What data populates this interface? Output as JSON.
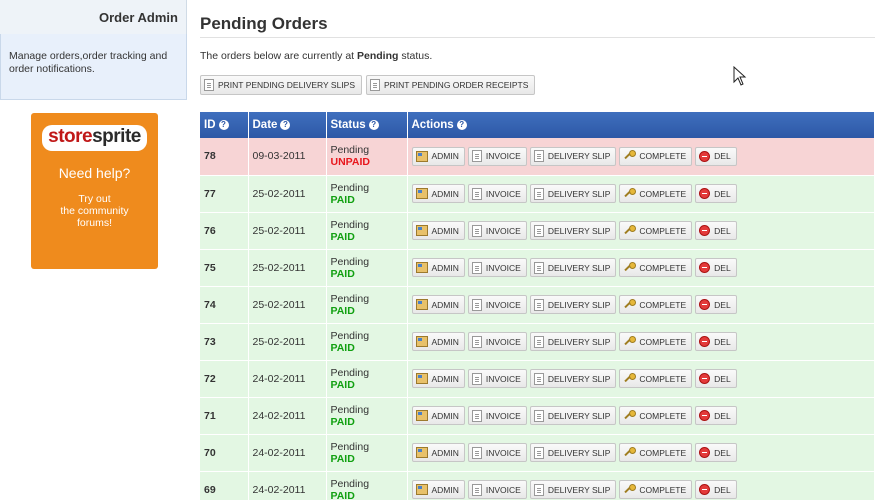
{
  "sidebar": {
    "title": "Order Admin",
    "description": "Manage orders,order tracking and order notifications.",
    "promo": {
      "logo_part1": "store",
      "logo_part2": "sprite",
      "help": "Need help?",
      "try_line1": "Try out",
      "try_line2": "the community",
      "try_line3": "forums!"
    }
  },
  "main": {
    "title": "Pending Orders",
    "intro_before": "The orders below are currently at ",
    "intro_status": "Pending",
    "intro_after": " status.",
    "buttons": {
      "print_slips": "PRINT PENDING DELIVERY SLIPS",
      "print_receipts": "PRINT PENDING ORDER RECEIPTS"
    }
  },
  "table": {
    "headers": [
      "ID",
      "Date",
      "Status",
      "Actions"
    ],
    "help_glyph": "?",
    "action_labels": {
      "admin": "ADMIN",
      "invoice": "INVOICE",
      "delivery": "DELIVERY SLIP",
      "complete": "COMPLETE",
      "del": "DEL"
    },
    "rows": [
      {
        "id": "78",
        "date": "09-03-2011",
        "status": "Pending",
        "payment": "UNPAID"
      },
      {
        "id": "77",
        "date": "25-02-2011",
        "status": "Pending",
        "payment": "PAID"
      },
      {
        "id": "76",
        "date": "25-02-2011",
        "status": "Pending",
        "payment": "PAID"
      },
      {
        "id": "75",
        "date": "25-02-2011",
        "status": "Pending",
        "payment": "PAID"
      },
      {
        "id": "74",
        "date": "25-02-2011",
        "status": "Pending",
        "payment": "PAID"
      },
      {
        "id": "73",
        "date": "25-02-2011",
        "status": "Pending",
        "payment": "PAID"
      },
      {
        "id": "72",
        "date": "24-02-2011",
        "status": "Pending",
        "payment": "PAID"
      },
      {
        "id": "71",
        "date": "24-02-2011",
        "status": "Pending",
        "payment": "PAID"
      },
      {
        "id": "70",
        "date": "24-02-2011",
        "status": "Pending",
        "payment": "PAID"
      },
      {
        "id": "69",
        "date": "24-02-2011",
        "status": "Pending",
        "payment": "PAID"
      }
    ]
  },
  "colors": {
    "header_blue": "#2d58a6",
    "unpaid_row": "#f7d4d5",
    "paid_row": "#e3f7e3",
    "unpaid_text": "#e8161c",
    "paid_text": "#11a011",
    "promo_orange": "#ef8b1d"
  },
  "icons": {
    "help": "question-circle-icon",
    "admin": "admin-panel-icon",
    "document": "document-icon",
    "complete": "key-icon",
    "delete": "delete-circle-icon",
    "cursor": "mouse-pointer-icon"
  }
}
